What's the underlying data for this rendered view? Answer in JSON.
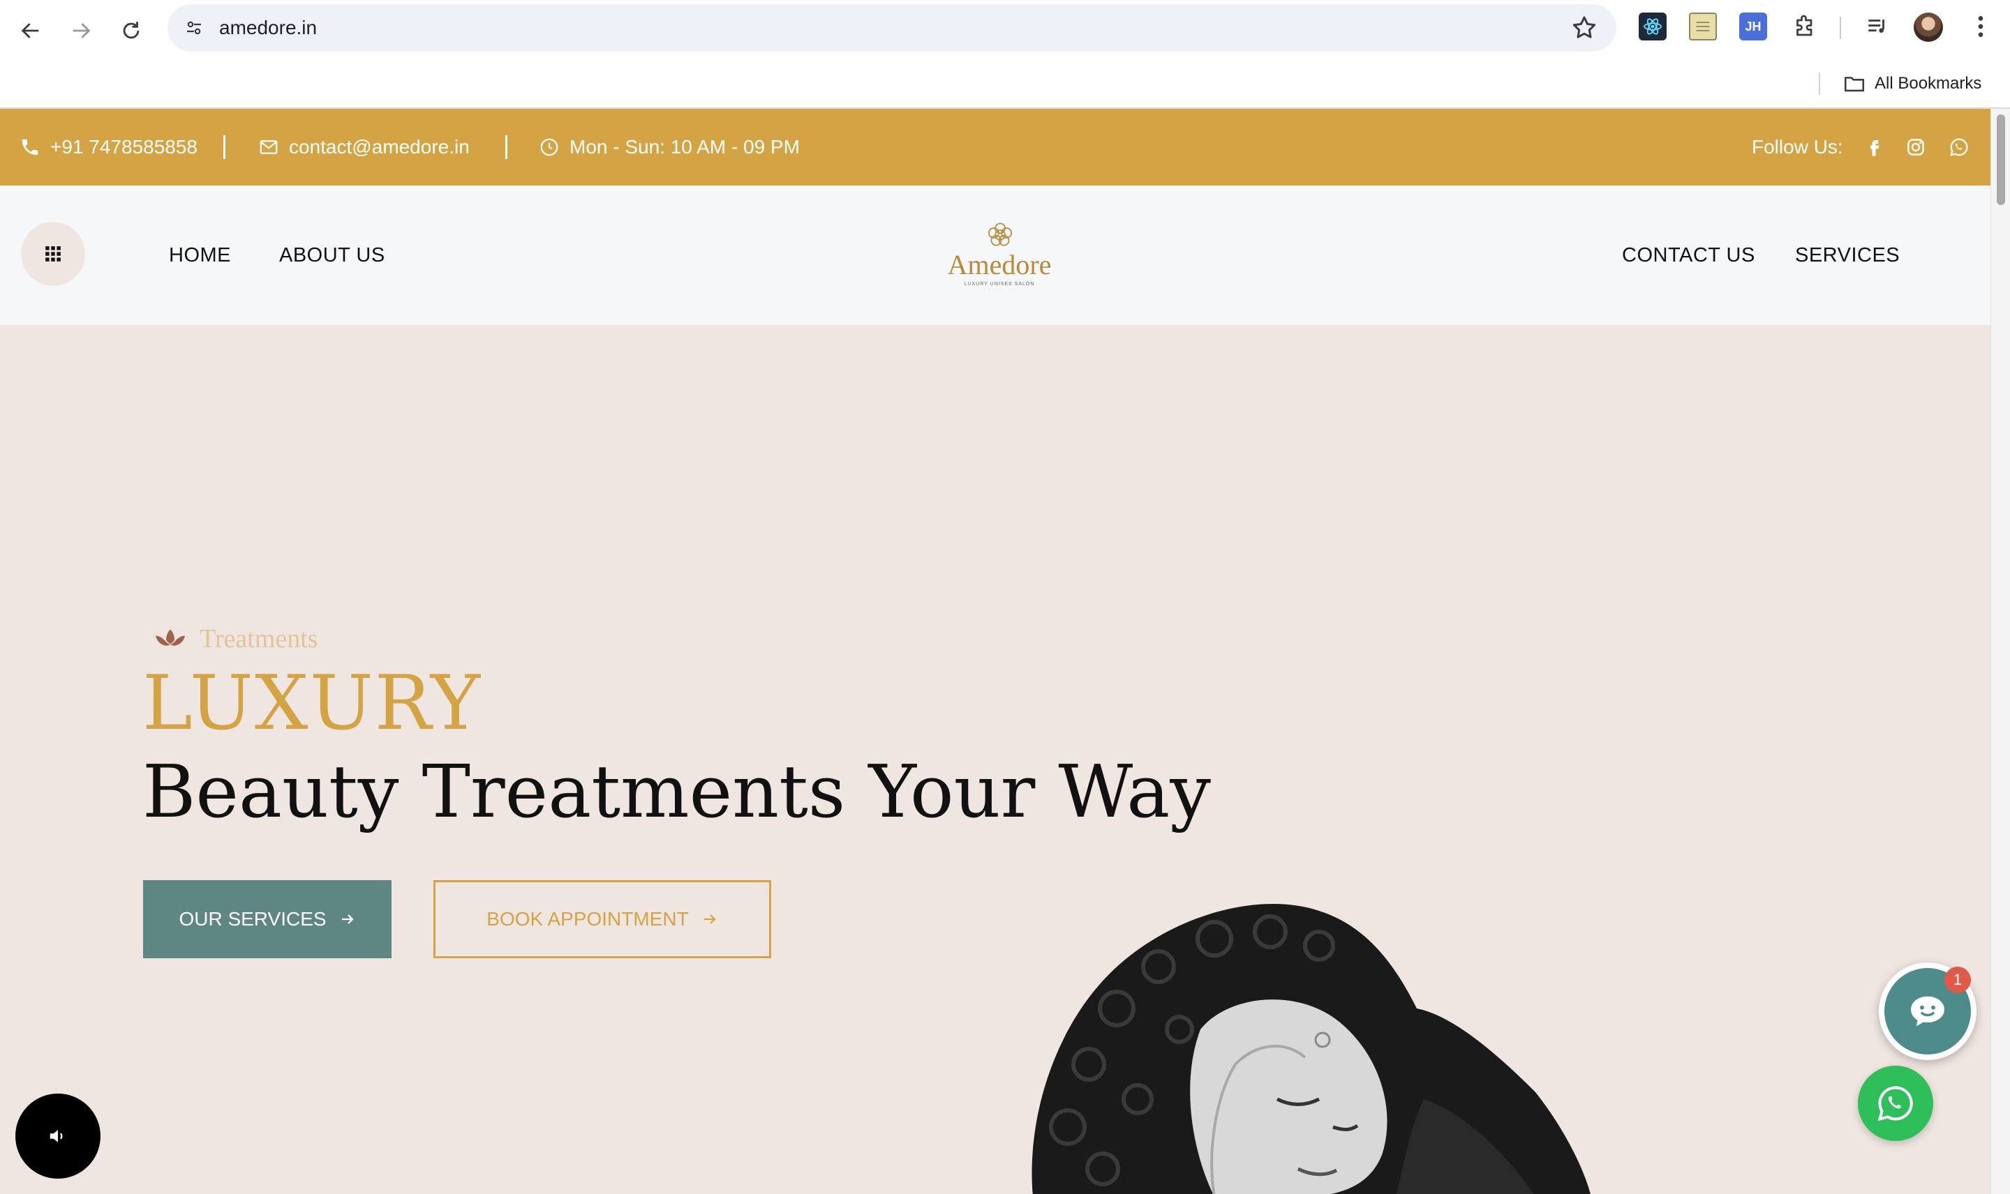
{
  "browser": {
    "url": "amedore.in",
    "bookmarks_label": "All Bookmarks",
    "extensions": {
      "jh_label": "JH"
    }
  },
  "topbar": {
    "phone": "+91 7478585858",
    "email": "contact@amedore.in",
    "hours": "Mon - Sun: 10 AM - 09 PM",
    "follow_label": "Follow Us:"
  },
  "nav": {
    "left": [
      "HOME",
      "ABOUT US"
    ],
    "right": [
      "CONTACT US",
      "SERVICES"
    ],
    "logo_name": "Amedore",
    "logo_tag": "LUXURY UNISEX SALON"
  },
  "hero": {
    "eyebrow": "Treatments",
    "title_accent": "LUXURY",
    "title_main": "Beauty Treatments Your Way",
    "primary_button": "OUR SERVICES",
    "secondary_button": "BOOK APPOINTMENT"
  },
  "widgets": {
    "chat_badge": "1"
  },
  "colors": {
    "gold": "#d4a343",
    "teal": "#5e8784",
    "hero_bg": "#f0e6e1",
    "whatsapp": "#2fbf5a"
  },
  "icons": {
    "back": "arrow-left-icon",
    "forward": "arrow-right-icon",
    "reload": "reload-icon",
    "site_info": "tune-icon",
    "bookmark_star": "star-icon",
    "phone": "phone-icon",
    "email": "mail-icon",
    "hours": "clock-icon",
    "facebook": "facebook-icon",
    "instagram": "instagram-icon",
    "whatsapp": "whatsapp-icon",
    "menu": "grid-icon",
    "chat": "chat-icon",
    "sound": "speaker-icon"
  }
}
